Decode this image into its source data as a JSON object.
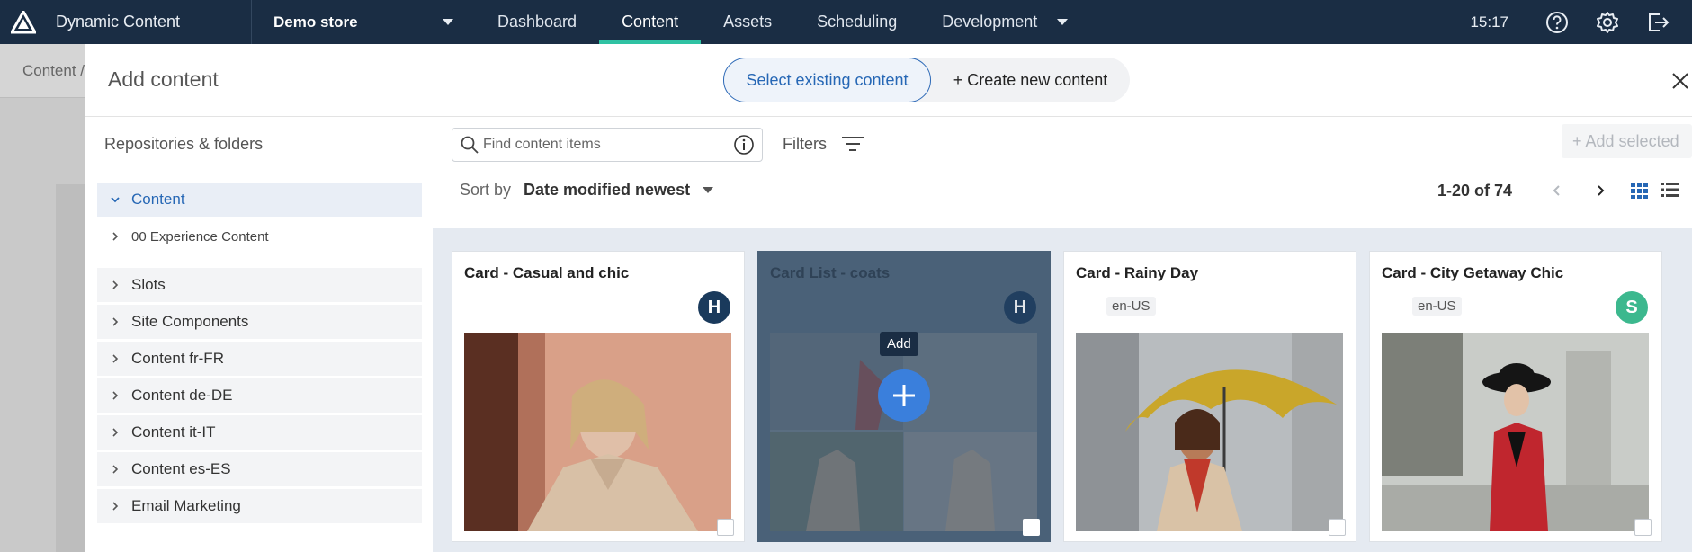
{
  "topbar": {
    "app_name": "Dynamic Content",
    "store": "Demo store",
    "tabs": [
      {
        "label": "Dashboard"
      },
      {
        "label": "Content"
      },
      {
        "label": "Assets"
      },
      {
        "label": "Scheduling"
      },
      {
        "label": "Development"
      }
    ],
    "time": "15:17",
    "icons": [
      "help-icon",
      "gear-icon",
      "logout-icon"
    ]
  },
  "background": {
    "breadcrumb": "Content /"
  },
  "modal": {
    "title": "Add content",
    "toggle": {
      "select_existing": "Select existing content",
      "create_new": "+ Create new content"
    },
    "sidebar": {
      "heading": "Repositories & folders",
      "items": [
        {
          "label": "Content"
        },
        {
          "label": "00 Experience Content"
        },
        {
          "label": "Slots"
        },
        {
          "label": "Site Components"
        },
        {
          "label": "Content fr-FR"
        },
        {
          "label": "Content de-DE"
        },
        {
          "label": "Content it-IT"
        },
        {
          "label": "Content es-ES"
        },
        {
          "label": "Email Marketing"
        }
      ]
    },
    "toolbar": {
      "search_placeholder": "Find content items",
      "filters_label": "Filters",
      "add_selected_label": "+ Add selected",
      "sort_label": "Sort by",
      "sort_value": "Date modified newest",
      "pager_text": "1-20 of 74"
    },
    "cards": [
      {
        "title": "Card - Casual and chic",
        "badge": "H",
        "badge_color": "#1a3a5c",
        "locale": ""
      },
      {
        "title": "Card List - coats",
        "badge": "H",
        "badge_color": "#1a3a5c",
        "locale": "",
        "tooltip": "Add"
      },
      {
        "title": "Card - Rainy Day",
        "badge": "",
        "locale": "en-US"
      },
      {
        "title": "Card - City Getaway Chic",
        "badge": "S",
        "badge_color": "#3cb88e",
        "locale": "en-US"
      }
    ]
  }
}
